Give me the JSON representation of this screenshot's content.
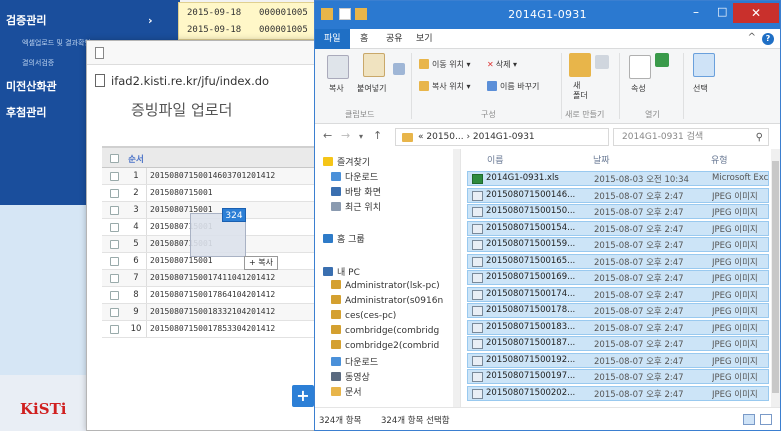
{
  "web": {
    "nav": {
      "items": [
        "검증관리",
        "미전산화관",
        "후첨관리"
      ],
      "subs": [
        "엑셀업로드 및 결과확인",
        "결의서검증"
      ]
    },
    "top_rows": [
      {
        "date": "2015-09-18",
        "num": "000001005"
      },
      {
        "date": "2015-09-18",
        "num": "000001005"
      }
    ],
    "logo": "KiSTi"
  },
  "popup": {
    "url": "ifad2.kisti.re.kr/jfu/index.do",
    "title": "증빙파일 업로더",
    "table_header": "순서",
    "rows": [
      {
        "n": "1",
        "name": "20150807150014603701201412"
      },
      {
        "n": "2",
        "name": "2015080715001"
      },
      {
        "n": "3",
        "name": "2015080715001"
      },
      {
        "n": "4",
        "name": "2015080715001"
      },
      {
        "n": "5",
        "name": "2015080715001"
      },
      {
        "n": "6",
        "name": "2015080715001"
      },
      {
        "n": "7",
        "name": "20150807150017411041201412"
      },
      {
        "n": "8",
        "name": "20150807150017864104201412"
      },
      {
        "n": "9",
        "name": "20150807150018332104201412"
      },
      {
        "n": "10",
        "name": "20150807150017853304201412"
      }
    ],
    "drag_count": "324",
    "copy_tip": "+ 복사",
    "add_label": "+"
  },
  "explorer": {
    "title": "2014G1-0931",
    "tabs": [
      "파일",
      "홈",
      "공유",
      "보기"
    ],
    "ribbon": {
      "copy": "복사",
      "paste": "붙여넣기",
      "move_to": "이동 위치 ▾",
      "delete": "삭제 ▾",
      "copy_to": "복사 위치 ▾",
      "rename": "이름 바꾸기",
      "new_folder": "새\n폴더",
      "properties": "속성",
      "select": "선택",
      "group_clipboard": "클립보드",
      "group_organize": "구성",
      "group_new": "새로 만들기",
      "group_open": "열기"
    },
    "address": "« 20150... › 2014G1-0931",
    "search_placeholder": "2014G1-0931 검색",
    "nav_pane": [
      "즐겨찾기",
      "다운로드",
      "바탕 화면",
      "최근 위치",
      "홈 그룹",
      "내 PC",
      "Administrator(lsk-pc)",
      "Administrator(s0916n",
      "ces(ces-pc)",
      "combridge(combridg",
      "combridge2(combrid",
      "다운로드",
      "동영상",
      "문서"
    ],
    "columns": [
      "이름",
      "날짜",
      "유형"
    ],
    "files": [
      {
        "name": "2014G1-0931.xls",
        "date": "2015-08-03 오전 10:34",
        "type": "Microsoft Exc",
        "kind": "xls"
      },
      {
        "name": "201508071500146...",
        "date": "2015-08-07 오후 2:47",
        "type": "JPEG 이미지",
        "kind": "img"
      },
      {
        "name": "201508071500150...",
        "date": "2015-08-07 오후 2:47",
        "type": "JPEG 이미지",
        "kind": "img"
      },
      {
        "name": "201508071500154...",
        "date": "2015-08-07 오후 2:47",
        "type": "JPEG 이미지",
        "kind": "img"
      },
      {
        "name": "201508071500159...",
        "date": "2015-08-07 오후 2:47",
        "type": "JPEG 이미지",
        "kind": "img"
      },
      {
        "name": "201508071500165...",
        "date": "2015-08-07 오후 2:47",
        "type": "JPEG 이미지",
        "kind": "img"
      },
      {
        "name": "201508071500169...",
        "date": "2015-08-07 오후 2:47",
        "type": "JPEG 이미지",
        "kind": "img"
      },
      {
        "name": "201508071500174...",
        "date": "2015-08-07 오후 2:47",
        "type": "JPEG 이미지",
        "kind": "img"
      },
      {
        "name": "201508071500178...",
        "date": "2015-08-07 오후 2:47",
        "type": "JPEG 이미지",
        "kind": "img"
      },
      {
        "name": "201508071500183...",
        "date": "2015-08-07 오후 2:47",
        "type": "JPEG 이미지",
        "kind": "img"
      },
      {
        "name": "201508071500187...",
        "date": "2015-08-07 오후 2:47",
        "type": "JPEG 이미지",
        "kind": "img"
      },
      {
        "name": "201508071500192...",
        "date": "2015-08-07 오후 2:47",
        "type": "JPEG 이미지",
        "kind": "img"
      },
      {
        "name": "201508071500197...",
        "date": "2015-08-07 오후 2:47",
        "type": "JPEG 이미지",
        "kind": "img"
      },
      {
        "name": "201508071500202...",
        "date": "2015-08-07 오후 2:47",
        "type": "JPEG 이미지",
        "kind": "img"
      }
    ],
    "status_count": "324개 항목",
    "status_selected": "324개 항목 선택함"
  },
  "colors": {
    "nav_blue": "#1a4e9c",
    "titlebar_blue": "#2b79d0",
    "selection": "#cce4f7",
    "close_red": "#c9302c"
  }
}
